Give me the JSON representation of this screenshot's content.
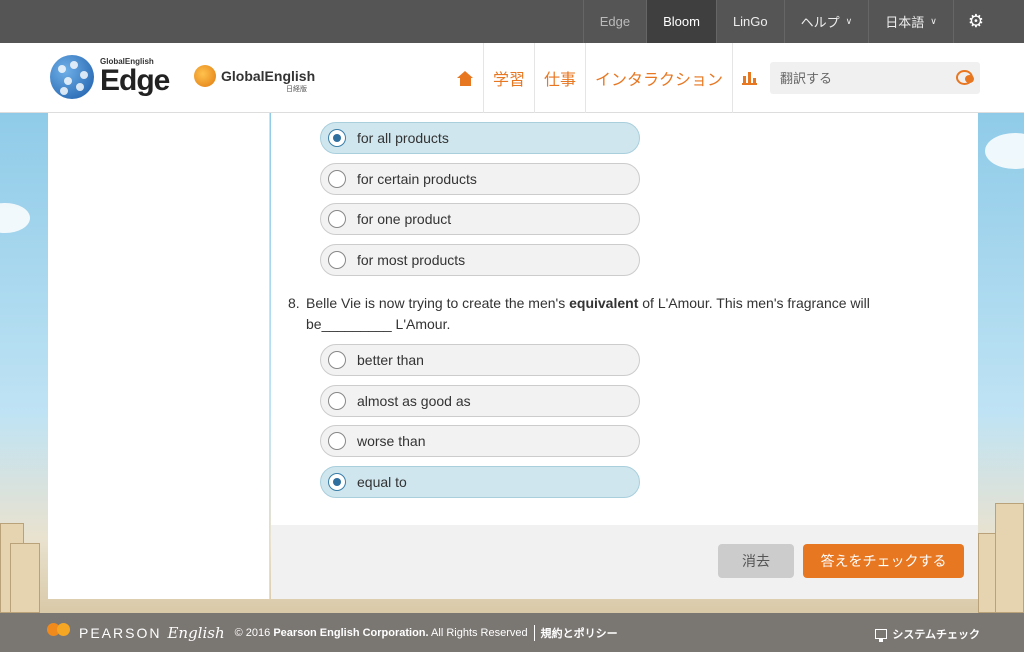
{
  "topbar": {
    "items": [
      {
        "label": "Edge"
      },
      {
        "label": "Bloom"
      },
      {
        "label": "LinGo"
      },
      {
        "label": "ヘルプ"
      },
      {
        "label": "日本語"
      }
    ]
  },
  "header": {
    "logo_edge_small": "GlobalEnglish",
    "logo_edge_big": "Edge",
    "logo_ge": "GlobalEnglish",
    "logo_ge_sub": "日経版",
    "nav": [
      {
        "label": "学習"
      },
      {
        "label": "仕事"
      },
      {
        "label": "インタラクション"
      }
    ],
    "search_placeholder": "翻訳する"
  },
  "question7": {
    "options": [
      {
        "label": "for all products",
        "selected": true
      },
      {
        "label": "for certain products",
        "selected": false
      },
      {
        "label": "for one product",
        "selected": false
      },
      {
        "label": "for most products",
        "selected": false
      }
    ]
  },
  "question8": {
    "number": "8.",
    "text_before": "Belle Vie is now trying to create the men's ",
    "text_bold": "equivalent",
    "text_after": " of L'Amour. This men's fragrance will",
    "line2": "be_________ L'Amour.",
    "options": [
      {
        "label": "better than",
        "selected": false
      },
      {
        "label": "almost as good as",
        "selected": false
      },
      {
        "label": "worse than",
        "selected": false
      },
      {
        "label": "equal to",
        "selected": true
      }
    ]
  },
  "actions": {
    "clear_label": "消去",
    "check_label": "答えをチェックする"
  },
  "footer": {
    "brand": "PEARSON",
    "brand_script": "English",
    "copyright_prefix": "© 2016 ",
    "copyright_bold": "Pearson English Corporation.",
    "copyright_suffix": " All Rights Reserved",
    "policy": "規約とポリシー",
    "system_check": "システムチェック"
  },
  "colors": {
    "accent": "#e87722",
    "selected_option": "#cfe6ee",
    "topbar": "#555555",
    "footer": "#7a7672"
  }
}
